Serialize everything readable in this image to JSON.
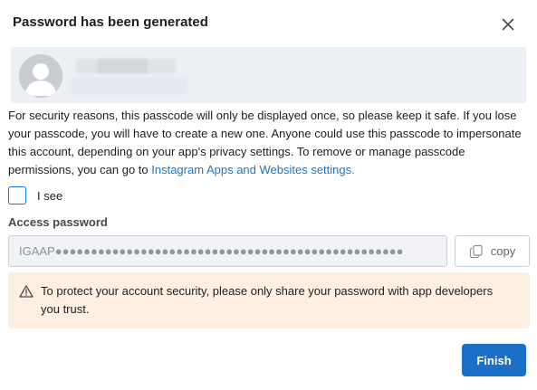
{
  "dialog": {
    "title": "Password has been generated",
    "close_icon": "close-icon"
  },
  "account": {
    "avatar_icon": "default-avatar-icon"
  },
  "notice": {
    "text": "For security reasons, this passcode will only be displayed once, so please keep it safe. If you lose your passcode, you will have to create a new one. Anyone could use this passcode to impersonate this account, depending on your app's privacy settings. To remove or manage passcode permissions, you can go to ",
    "link_text": "Instagram Apps and Websites settings."
  },
  "acknowledge": {
    "label": "I see",
    "checked": false
  },
  "password": {
    "label": "Access password",
    "prefix": "IGAAP",
    "masked": "●●●●●●●●●●●●●●●●●●●●●●●●●●●●●●●●●●●●●●●●●●●●●●●●●"
  },
  "copy": {
    "label": "copy",
    "icon": "copy-icon"
  },
  "warning": {
    "icon": "warning-triangle-icon",
    "text": "To protect your account security, please only share your password with app developers you trust."
  },
  "actions": {
    "finish_label": "Finish"
  },
  "colors": {
    "primary": "#1b6fc6",
    "link": "#1877c4",
    "warning_bg": "#fdf0e3"
  }
}
